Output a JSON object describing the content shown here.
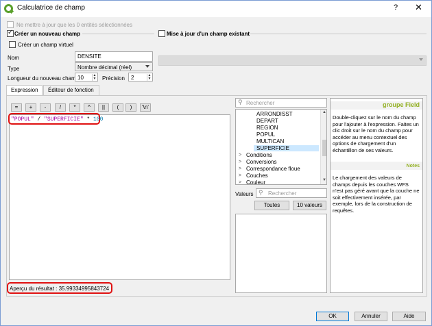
{
  "window": {
    "title": "Calculatrice de champ",
    "help": "?",
    "close": "✕"
  },
  "top": {
    "update_selected": "Ne mettre à jour que les 0 entités sélectionnées",
    "create_new": "Créer un nouveau champ",
    "update_existing": "Mise à jour d'un champ existant",
    "create_virtual": "Créer un champ virtuel",
    "name_label": "Nom",
    "name_value": "DENSITE",
    "type_label": "Type",
    "type_value": "Nombre décimal (réel)",
    "length_label": "Longueur du nouveau champ",
    "length_value": "10",
    "precision_label": "Précision",
    "precision_value": "2"
  },
  "tabs": [
    "Expression",
    "Éditeur de fonction"
  ],
  "operators": [
    "=",
    "+",
    "-",
    "/",
    "*",
    "^",
    "||",
    "(",
    ")",
    "'\\n'"
  ],
  "expression": {
    "part1": "\"POPUL\"",
    "op1": " / ",
    "part2": "\"SUPERFICIE\"",
    "op2": " * ",
    "num": "100"
  },
  "preview": {
    "label": "Aperçu du résultat :",
    "value": "35.99334995843724"
  },
  "search": {
    "placeholder": "Rechercher"
  },
  "tree": {
    "fields": [
      "ARRONDISST",
      "DEPART",
      "REGION",
      "POPUL",
      "MULTICAN",
      "SUPERFICIE"
    ],
    "selected": "SUPERFICIE",
    "groups": [
      "Conditions",
      "Conversions",
      "Correspondance floue",
      "Couches",
      "Couleur"
    ]
  },
  "values": {
    "label": "Valeurs",
    "placeholder": "Rechercher",
    "all_button": "Toutes",
    "ten_button": "10 valeurs"
  },
  "help": {
    "title": "groupe Field",
    "para1": "Double-cliquez sur le nom du champ pour l'ajouter à l'expression. Faites un clic droit sur le nom du champ pour accéder au menu contextuel des options de chargement d'un échantillon de ses valeurs.",
    "notes": "Notes",
    "para2": "Le chargement des valeurs de champs depuis les couches WFS n'est pas géré avant que la couche ne soit effectivement insérée, par exemple, lors de la construction de requêtes."
  },
  "buttons": {
    "ok": "OK",
    "cancel": "Annuler",
    "help": "Aide"
  },
  "colors": {
    "highlight": "#e01010",
    "accent": "#93b023",
    "selection": "#cce8ff"
  }
}
